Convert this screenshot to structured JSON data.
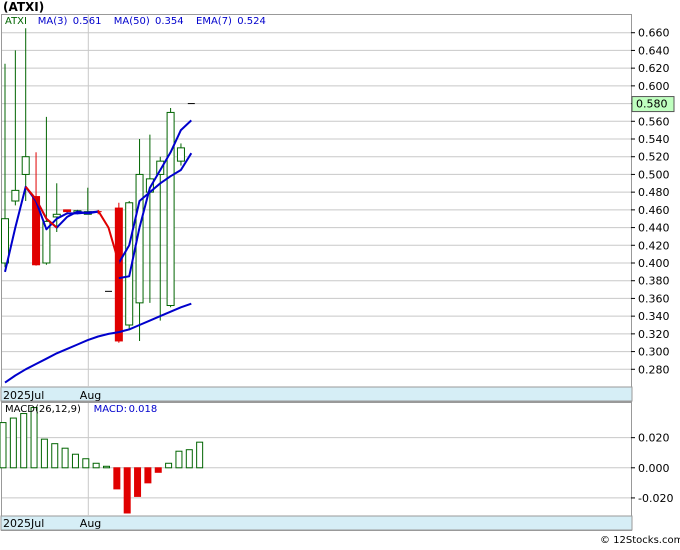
{
  "title": "(ATXI)",
  "footer": "© 12Stocks.com",
  "colors": {
    "up": "#006400",
    "down": "#e00000",
    "ma_blue": "#0000cc",
    "ema_red": "#e00000",
    "axis_band": "#d6eef6",
    "grid": "#c8c8c8",
    "price_tag_bg": "#bfffbf"
  },
  "chart_data": [
    {
      "type": "candlestick",
      "legend": [
        {
          "label": "ATXI",
          "color": "#006400"
        },
        {
          "label": "MA(3)",
          "value": "0.561",
          "color": "#0000cc"
        },
        {
          "label": "MA(50)",
          "value": "0.354",
          "color": "#0000cc"
        },
        {
          "label": "EMA(7)",
          "value": "0.524",
          "color": "#0000cc"
        }
      ],
      "ylim": [
        0.26,
        0.68
      ],
      "yticks": [
        0.28,
        0.3,
        0.32,
        0.34,
        0.36,
        0.38,
        0.4,
        0.42,
        0.44,
        0.46,
        0.48,
        0.5,
        0.52,
        0.54,
        0.56,
        0.58,
        0.6,
        0.62,
        0.64,
        0.66
      ],
      "ytick_labels": [
        "0.280",
        "0.300",
        "0.320",
        "0.340",
        "0.360",
        "0.380",
        "0.400",
        "0.420",
        "0.440",
        "0.460",
        "0.480",
        "0.500",
        "0.520",
        "0.540",
        "0.560",
        "0.580",
        "0.600",
        "0.620",
        "0.640",
        "0.660"
      ],
      "last_price": "0.580",
      "x_labels": [
        {
          "index": 0,
          "label": "2025Jul"
        },
        {
          "index": 8,
          "label": "Aug"
        }
      ],
      "candles": [
        {
          "o": 0.4,
          "h": 0.625,
          "l": 0.395,
          "c": 0.45
        },
        {
          "o": 0.47,
          "h": 0.64,
          "l": 0.465,
          "c": 0.482
        },
        {
          "o": 0.5,
          "h": 0.665,
          "l": 0.47,
          "c": 0.52
        },
        {
          "o": 0.475,
          "h": 0.525,
          "l": 0.397,
          "c": 0.398
        },
        {
          "o": 0.4,
          "h": 0.565,
          "l": 0.398,
          "c": 0.447
        },
        {
          "o": 0.452,
          "h": 0.49,
          "l": 0.435,
          "c": 0.455
        },
        {
          "o": 0.46,
          "h": 0.46,
          "l": 0.455,
          "c": 0.458
        },
        {
          "o": 0.457,
          "h": 0.46,
          "l": 0.455,
          "c": 0.459
        },
        {
          "o": 0.455,
          "h": 0.485,
          "l": 0.455,
          "c": 0.458
        },
        {
          "o": 0.458,
          "h": 0.46,
          "l": 0.455,
          "c": 0.457
        },
        {
          "o": 0.368,
          "h": 0.368,
          "l": 0.368,
          "c": 0.368
        },
        {
          "o": 0.462,
          "h": 0.468,
          "l": 0.31,
          "c": 0.312
        },
        {
          "o": 0.33,
          "h": 0.47,
          "l": 0.325,
          "c": 0.468
        },
        {
          "o": 0.355,
          "h": 0.54,
          "l": 0.312,
          "c": 0.5
        },
        {
          "o": 0.48,
          "h": 0.545,
          "l": 0.355,
          "c": 0.495
        },
        {
          "o": 0.5,
          "h": 0.52,
          "l": 0.335,
          "c": 0.515
        },
        {
          "o": 0.352,
          "h": 0.575,
          "l": 0.35,
          "c": 0.57
        },
        {
          "o": 0.515,
          "h": 0.535,
          "l": 0.51,
          "c": 0.53
        },
        {
          "o": 0.58,
          "h": 0.58,
          "l": 0.58,
          "c": 0.58
        }
      ],
      "ma3": [
        0.39,
        0.44,
        0.486,
        0.47,
        0.438,
        0.45,
        0.456,
        0.456,
        0.457,
        0.458,
        null,
        0.383,
        0.385,
        0.44,
        0.485,
        0.505,
        0.525,
        0.55,
        0.561
      ],
      "ema7": [
        null,
        null,
        null,
        0.472,
        0.45,
        0.44,
        0.452,
        0.458,
        0.456,
        0.458,
        null,
        0.4,
        0.42,
        0.47,
        0.48,
        0.49,
        0.498,
        0.505,
        0.524
      ],
      "ma50": [
        0.265,
        0.273,
        0.28,
        0.286,
        0.292,
        0.298,
        0.303,
        0.308,
        0.313,
        0.317,
        0.32,
        0.322,
        0.325,
        0.33,
        0.335,
        0.34,
        0.345,
        0.35,
        0.354
      ],
      "ema_red_segments": [
        [
          2,
          5
        ],
        [
          9,
          11
        ]
      ]
    },
    {
      "type": "bar",
      "legend": [
        {
          "label": "MACD(26,12,9)",
          "color": "#000000"
        },
        {
          "label": "MACD:",
          "value": "0.018",
          "color": "#0000cc"
        }
      ],
      "ylim": [
        -0.032,
        0.043
      ],
      "yticks": [
        0.02,
        0.0,
        -0.02
      ],
      "ytick_labels": [
        "0.020",
        "0.000",
        "-0.020"
      ],
      "x_labels": [
        {
          "index": 0,
          "label": "2025Jul"
        },
        {
          "index": 8,
          "label": "Aug"
        }
      ],
      "values": [
        0.03,
        0.033,
        0.036,
        0.04,
        0.019,
        0.016,
        0.013,
        0.009,
        0.006,
        0.003,
        0.001,
        -0.014,
        -0.03,
        -0.019,
        -0.01,
        -0.003,
        0.003,
        0.011,
        0.012,
        0.017
      ]
    }
  ]
}
